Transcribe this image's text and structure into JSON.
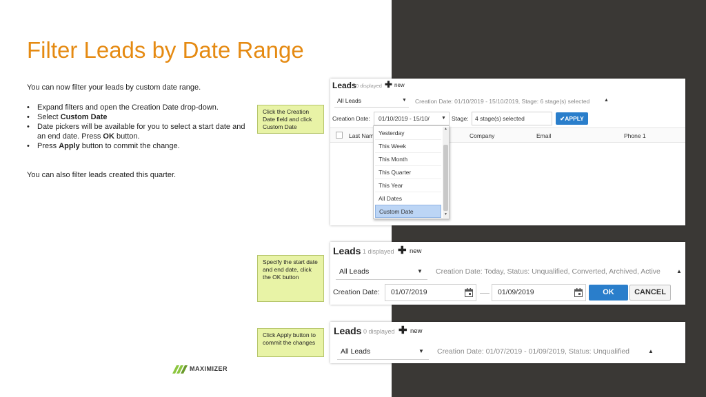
{
  "slide": {
    "title": "Filter Leads by Date Range",
    "intro": "You can now filter your leads by custom date range.",
    "bullets": [
      {
        "pre": "Expand filters and open the Creation Date drop-down.",
        "bold": "",
        "post": ""
      },
      {
        "pre": "Select ",
        "bold": "Custom Date",
        "post": ""
      },
      {
        "pre": "Date pickers will be available for you to select a start date and an end date. Press ",
        "bold": "OK",
        "post": " button."
      },
      {
        "pre": "Press ",
        "bold": "Apply",
        "post": " button to commit the change."
      }
    ],
    "quarter_note": "You can also filter leads created this quarter.",
    "logo_text": "MAXIMIZER"
  },
  "callouts": [
    "Click the Creation Date field and click Custom Date",
    "Specify the start date and end date, click the OK button",
    "Click Apply button to commit the changes"
  ],
  "shot1": {
    "leads": "Leads",
    "displayed": "0 displayed",
    "new": "new",
    "view": "All Leads",
    "summary": "Creation Date: 01/10/2019 - 15/10/2019, Stage: 6 stage(s) selected",
    "creation_label": "Creation Date:",
    "creation_value": "01/10/2019 - 15/10/",
    "stage_label": "Stage:",
    "stage_value": "4 stage(s) selected",
    "apply": "APPLY",
    "columns": [
      "Last Nam",
      "Company",
      "Email",
      "Phone 1"
    ],
    "dropdown": [
      "Yesterday",
      "This Week",
      "This Month",
      "This Quarter",
      "This Year",
      "All Dates",
      "Custom Date"
    ],
    "selected": "Custom Date"
  },
  "shot2": {
    "leads": "Leads",
    "displayed": "1 displayed",
    "new": "new",
    "view": "All Leads",
    "summary": "Creation Date: Today, Status: Unqualified, Converted, Archived, Active",
    "creation_label": "Creation Date:",
    "start_date": "01/07/2019",
    "end_date": "01/09/2019",
    "ok": "OK",
    "cancel": "CANCEL"
  },
  "shot3": {
    "leads": "Leads",
    "displayed": "0 displayed",
    "new": "new",
    "view": "All Leads",
    "summary": "Creation Date: 01/07/2019 - 01/09/2019, Status: Unqualified"
  },
  "icons": [
    "plus-icon",
    "caret-down-icon",
    "caret-up-icon",
    "calendar-icon",
    "checkmark-icon",
    "checkbox-icon",
    "scroll-up-icon",
    "scroll-down-icon",
    "maximizer-logo-icon"
  ],
  "colors": {
    "title": "#e58a12",
    "callout_bg": "#e8f3a6",
    "dark_panel": "#3a3835",
    "primary_button": "#2a7ecb",
    "selected_item": "#bcd5f5"
  }
}
